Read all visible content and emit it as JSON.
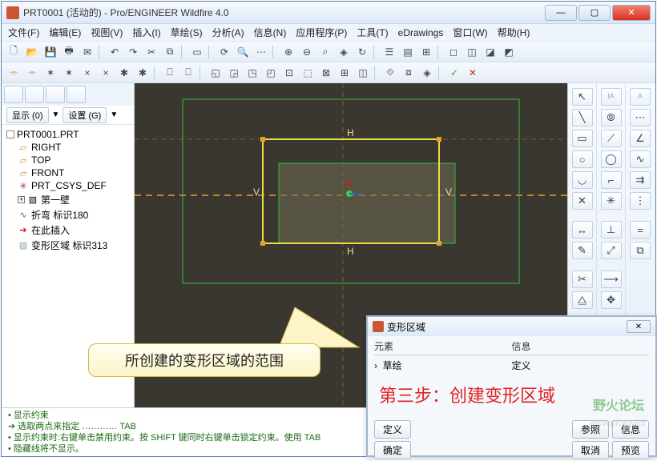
{
  "window": {
    "title": "PRT0001 (活动的) - Pro/ENGINEER Wildfire 4.0"
  },
  "menu": [
    "文件(F)",
    "编辑(E)",
    "视图(V)",
    "插入(I)",
    "草绘(S)",
    "分析(A)",
    "信息(N)",
    "应用程序(P)",
    "工具(T)",
    "eDrawings",
    "窗口(W)",
    "帮助(H)"
  ],
  "sidebar": {
    "display_label": "显示 (0)",
    "settings_label": "设置 (G)",
    "root": "PRT0001.PRT",
    "items": [
      "RIGHT",
      "TOP",
      "FRONT",
      "PRT_CSYS_DEF",
      "第一壁",
      "折弯 标识180",
      "在此插入",
      "变形区域 标识313"
    ]
  },
  "canvas": {
    "labels": {
      "h": "H",
      "v": "V"
    }
  },
  "callout": "所创建的变形区域的范围",
  "dialog": {
    "title": "变形区域",
    "col1": "元素",
    "col2": "信息",
    "row_el": "草绘",
    "row_info": "定义",
    "red_step": "第三步：创建变形区域",
    "btn_define": "定义",
    "btn_ref": "参照",
    "btn_info": "信息",
    "btn_ok": "确定",
    "btn_cancel": "取消",
    "btn_preview": "预览"
  },
  "status": [
    "显示约束",
    "选取两点来指定",
    "显示约束时:右键单击禁用约束。按 SHIFT 键同时右键单击锁定约束。使用 TAB",
    "隐藏线将不显示。"
  ],
  "watermark": {
    "logo": "野火论坛",
    "url": "www.proewildf"
  }
}
